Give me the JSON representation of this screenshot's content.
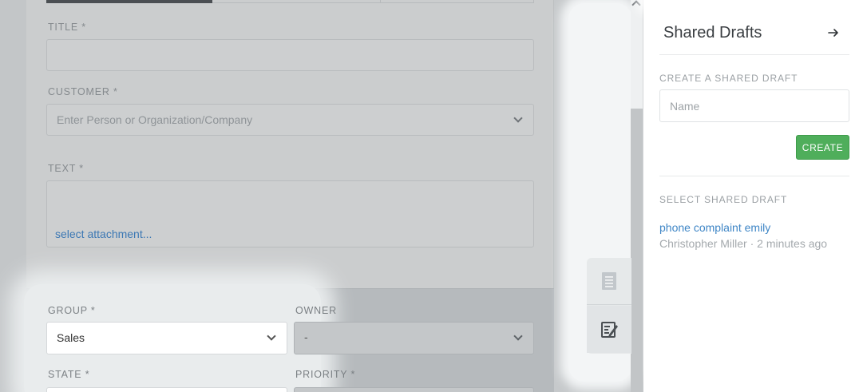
{
  "form": {
    "title_label": "TITLE *",
    "customer_label": "CUSTOMER *",
    "customer_placeholder": "Enter Person or Organization/Company",
    "text_label": "TEXT *",
    "attachment_link": "select attachment...",
    "group_label": "GROUP *",
    "group_value": "Sales",
    "owner_label": "OWNER",
    "owner_value": "-",
    "state_label": "STATE *",
    "priority_label": "PRIORITY *"
  },
  "sidebar_tabs": [
    {
      "icon": "ticket-template-icon"
    },
    {
      "icon": "shared-draft-icon"
    }
  ],
  "panel": {
    "title": "Shared Drafts",
    "close_icon": "arrow-right-icon",
    "create_label": "CREATE A SHARED DRAFT",
    "name_placeholder": "Name",
    "create_button": "CREATE",
    "select_label": "SELECT SHARED DRAFT",
    "drafts": [
      {
        "name": "phone complaint emily",
        "meta": "Christopher Miller · 2 minutes ago"
      }
    ]
  },
  "colors": {
    "accent_green": "#4fae5b",
    "link_blue": "#3f86c6"
  }
}
